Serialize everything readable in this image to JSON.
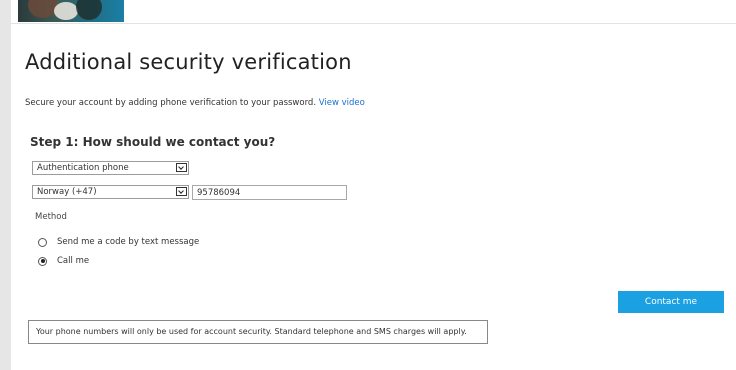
{
  "header": {
    "banner_image": "banner-photo"
  },
  "page": {
    "title": "Additional security verification",
    "intro_text": "Secure your account by adding phone verification to your password.",
    "intro_link": "View video"
  },
  "step1": {
    "title": "Step 1: How should we contact you?",
    "contact_method": {
      "selected": "Authentication phone"
    },
    "country": {
      "selected": "Norway (+47)"
    },
    "phone_number": {
      "value": "95786094"
    },
    "method_label": "Method",
    "options": [
      {
        "label": "Send me a code by text message",
        "checked": false
      },
      {
        "label": "Call me",
        "checked": true
      }
    ]
  },
  "actions": {
    "contact_label": "Contact me",
    "accent_color": "#1ba1e2"
  },
  "notice": {
    "text": "Your phone numbers will only be used for account security. Standard telephone and SMS charges will apply."
  }
}
